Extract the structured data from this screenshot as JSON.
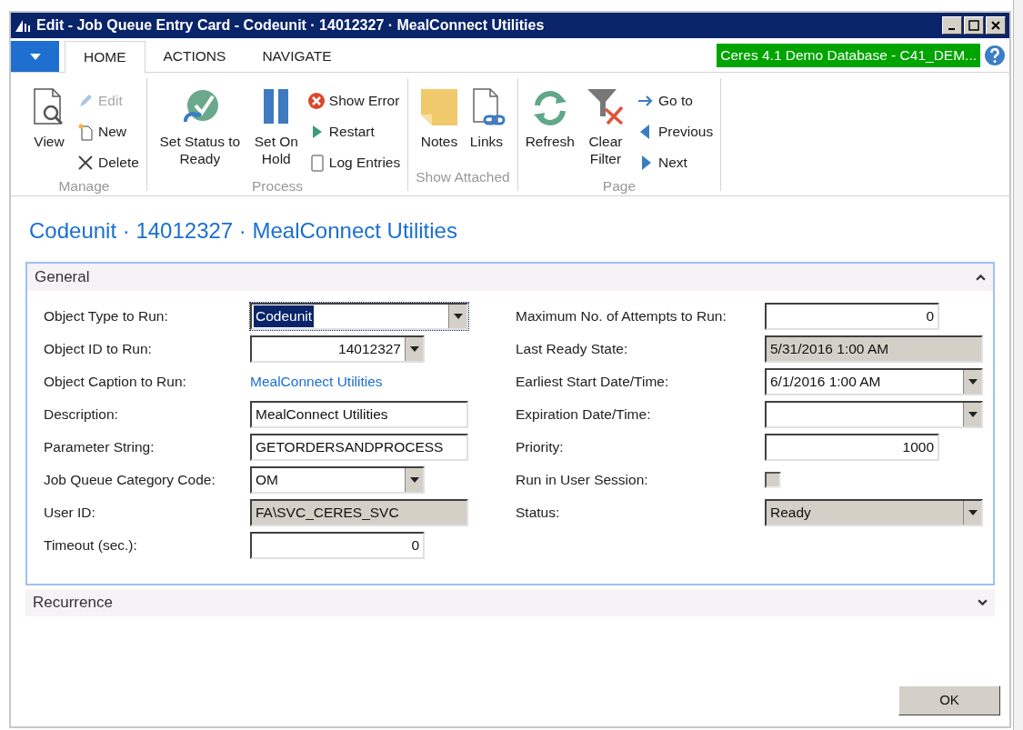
{
  "window": {
    "title": "Edit - Job Queue Entry Card - Codeunit · 14012327 · MealConnect Utilities"
  },
  "tabs": [
    {
      "label": "HOME",
      "selected": true
    },
    {
      "label": "ACTIONS",
      "selected": false
    },
    {
      "label": "NAVIGATE",
      "selected": false
    }
  ],
  "database_badge": "Ceres 4.1 Demo Database - C41_DEM...",
  "ribbon_groups": [
    {
      "label": "Manage",
      "buttons": [
        {
          "label": "View",
          "kind": "big",
          "disabled": false
        },
        {
          "label": "Edit",
          "kind": "small",
          "disabled": true
        },
        {
          "label": "New",
          "kind": "small",
          "disabled": false
        },
        {
          "label": "Delete",
          "kind": "small",
          "disabled": false
        }
      ]
    },
    {
      "label": "Process",
      "buttons": [
        {
          "label": "Set Status to Ready",
          "kind": "big",
          "disabled": false
        },
        {
          "label": "Set On Hold",
          "kind": "big",
          "disabled": false
        },
        {
          "label": "Show Error",
          "kind": "small",
          "disabled": false
        },
        {
          "label": "Restart",
          "kind": "small",
          "disabled": false
        },
        {
          "label": "Log Entries",
          "kind": "small",
          "disabled": false
        }
      ]
    },
    {
      "label": "Show Attached",
      "buttons": [
        {
          "label": "Notes",
          "kind": "big",
          "disabled": false
        },
        {
          "label": "Links",
          "kind": "big",
          "disabled": false
        }
      ]
    },
    {
      "label": "Page",
      "buttons": [
        {
          "label": "Refresh",
          "kind": "big",
          "disabled": false
        },
        {
          "label": "Clear Filter",
          "kind": "big",
          "disabled": false
        },
        {
          "label": "Go to",
          "kind": "small",
          "disabled": false
        },
        {
          "label": "Previous",
          "kind": "small",
          "disabled": false
        },
        {
          "label": "Next",
          "kind": "small",
          "disabled": false
        }
      ]
    }
  ],
  "page_title": "Codeunit · 14012327 · MealConnect Utilities",
  "sections": [
    {
      "title": "General",
      "expanded": true,
      "left_fields": [
        {
          "label": "Object Type to Run:",
          "kind": "dropdown",
          "value": "Codeunit",
          "focused": true
        },
        {
          "label": "Object ID to Run:",
          "kind": "dropdown",
          "value": "14012327",
          "focused": false
        },
        {
          "label": "Object Caption to Run:",
          "kind": "link",
          "value": "MealConnect Utilities",
          "focused": false
        },
        {
          "label": "Description:",
          "kind": "text",
          "value": "MealConnect Utilities",
          "focused": false
        },
        {
          "label": "Parameter String:",
          "kind": "text",
          "value": "GETORDERSANDPROCESS",
          "focused": false
        },
        {
          "label": "Job Queue Category Code:",
          "kind": "dropdown",
          "value": "OM",
          "focused": false
        },
        {
          "label": "User ID:",
          "kind": "readonly",
          "value": "FA\\SVC_CERES_SVC",
          "focused": false
        },
        {
          "label": "Timeout (sec.):",
          "kind": "text",
          "value": "0",
          "focused": false
        }
      ],
      "right_fields": [
        {
          "label": "Maximum No. of Attempts to Run:",
          "kind": "text",
          "value": "0",
          "focused": false
        },
        {
          "label": "Last Ready State:",
          "kind": "readonly",
          "value": "5/31/2016 1:00 AM",
          "focused": false
        },
        {
          "label": "Earliest Start Date/Time:",
          "kind": "dropdown",
          "value": "6/1/2016 1:00 AM",
          "focused": false
        },
        {
          "label": "Expiration Date/Time:",
          "kind": "dropdown",
          "focused": false
        },
        {
          "label": "Priority:",
          "kind": "text",
          "value": "1000",
          "focused": false
        },
        {
          "label": "Run in User Session:",
          "kind": "checkbox",
          "checked": false,
          "focused": false
        },
        {
          "label": "Status:",
          "kind": "readonly_dropdown",
          "value": "Ready",
          "focused": false
        }
      ]
    },
    {
      "title": "Recurrence",
      "expanded": false
    }
  ],
  "ok_button": "OK"
}
